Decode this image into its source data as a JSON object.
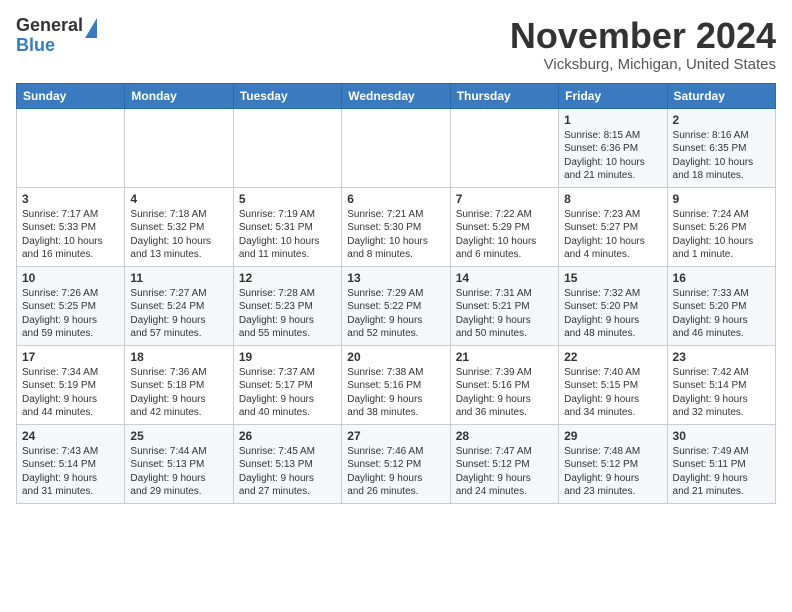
{
  "header": {
    "logo_general": "General",
    "logo_blue": "Blue",
    "month_title": "November 2024",
    "location": "Vicksburg, Michigan, United States"
  },
  "weekdays": [
    "Sunday",
    "Monday",
    "Tuesday",
    "Wednesday",
    "Thursday",
    "Friday",
    "Saturday"
  ],
  "weeks": [
    [
      {
        "day": "",
        "info": ""
      },
      {
        "day": "",
        "info": ""
      },
      {
        "day": "",
        "info": ""
      },
      {
        "day": "",
        "info": ""
      },
      {
        "day": "",
        "info": ""
      },
      {
        "day": "1",
        "info": "Sunrise: 8:15 AM\nSunset: 6:36 PM\nDaylight: 10 hours\nand 21 minutes."
      },
      {
        "day": "2",
        "info": "Sunrise: 8:16 AM\nSunset: 6:35 PM\nDaylight: 10 hours\nand 18 minutes."
      }
    ],
    [
      {
        "day": "3",
        "info": "Sunrise: 7:17 AM\nSunset: 5:33 PM\nDaylight: 10 hours\nand 16 minutes."
      },
      {
        "day": "4",
        "info": "Sunrise: 7:18 AM\nSunset: 5:32 PM\nDaylight: 10 hours\nand 13 minutes."
      },
      {
        "day": "5",
        "info": "Sunrise: 7:19 AM\nSunset: 5:31 PM\nDaylight: 10 hours\nand 11 minutes."
      },
      {
        "day": "6",
        "info": "Sunrise: 7:21 AM\nSunset: 5:30 PM\nDaylight: 10 hours\nand 8 minutes."
      },
      {
        "day": "7",
        "info": "Sunrise: 7:22 AM\nSunset: 5:29 PM\nDaylight: 10 hours\nand 6 minutes."
      },
      {
        "day": "8",
        "info": "Sunrise: 7:23 AM\nSunset: 5:27 PM\nDaylight: 10 hours\nand 4 minutes."
      },
      {
        "day": "9",
        "info": "Sunrise: 7:24 AM\nSunset: 5:26 PM\nDaylight: 10 hours\nand 1 minute."
      }
    ],
    [
      {
        "day": "10",
        "info": "Sunrise: 7:26 AM\nSunset: 5:25 PM\nDaylight: 9 hours\nand 59 minutes."
      },
      {
        "day": "11",
        "info": "Sunrise: 7:27 AM\nSunset: 5:24 PM\nDaylight: 9 hours\nand 57 minutes."
      },
      {
        "day": "12",
        "info": "Sunrise: 7:28 AM\nSunset: 5:23 PM\nDaylight: 9 hours\nand 55 minutes."
      },
      {
        "day": "13",
        "info": "Sunrise: 7:29 AM\nSunset: 5:22 PM\nDaylight: 9 hours\nand 52 minutes."
      },
      {
        "day": "14",
        "info": "Sunrise: 7:31 AM\nSunset: 5:21 PM\nDaylight: 9 hours\nand 50 minutes."
      },
      {
        "day": "15",
        "info": "Sunrise: 7:32 AM\nSunset: 5:20 PM\nDaylight: 9 hours\nand 48 minutes."
      },
      {
        "day": "16",
        "info": "Sunrise: 7:33 AM\nSunset: 5:20 PM\nDaylight: 9 hours\nand 46 minutes."
      }
    ],
    [
      {
        "day": "17",
        "info": "Sunrise: 7:34 AM\nSunset: 5:19 PM\nDaylight: 9 hours\nand 44 minutes."
      },
      {
        "day": "18",
        "info": "Sunrise: 7:36 AM\nSunset: 5:18 PM\nDaylight: 9 hours\nand 42 minutes."
      },
      {
        "day": "19",
        "info": "Sunrise: 7:37 AM\nSunset: 5:17 PM\nDaylight: 9 hours\nand 40 minutes."
      },
      {
        "day": "20",
        "info": "Sunrise: 7:38 AM\nSunset: 5:16 PM\nDaylight: 9 hours\nand 38 minutes."
      },
      {
        "day": "21",
        "info": "Sunrise: 7:39 AM\nSunset: 5:16 PM\nDaylight: 9 hours\nand 36 minutes."
      },
      {
        "day": "22",
        "info": "Sunrise: 7:40 AM\nSunset: 5:15 PM\nDaylight: 9 hours\nand 34 minutes."
      },
      {
        "day": "23",
        "info": "Sunrise: 7:42 AM\nSunset: 5:14 PM\nDaylight: 9 hours\nand 32 minutes."
      }
    ],
    [
      {
        "day": "24",
        "info": "Sunrise: 7:43 AM\nSunset: 5:14 PM\nDaylight: 9 hours\nand 31 minutes."
      },
      {
        "day": "25",
        "info": "Sunrise: 7:44 AM\nSunset: 5:13 PM\nDaylight: 9 hours\nand 29 minutes."
      },
      {
        "day": "26",
        "info": "Sunrise: 7:45 AM\nSunset: 5:13 PM\nDaylight: 9 hours\nand 27 minutes."
      },
      {
        "day": "27",
        "info": "Sunrise: 7:46 AM\nSunset: 5:12 PM\nDaylight: 9 hours\nand 26 minutes."
      },
      {
        "day": "28",
        "info": "Sunrise: 7:47 AM\nSunset: 5:12 PM\nDaylight: 9 hours\nand 24 minutes."
      },
      {
        "day": "29",
        "info": "Sunrise: 7:48 AM\nSunset: 5:12 PM\nDaylight: 9 hours\nand 23 minutes."
      },
      {
        "day": "30",
        "info": "Sunrise: 7:49 AM\nSunset: 5:11 PM\nDaylight: 9 hours\nand 21 minutes."
      }
    ]
  ]
}
